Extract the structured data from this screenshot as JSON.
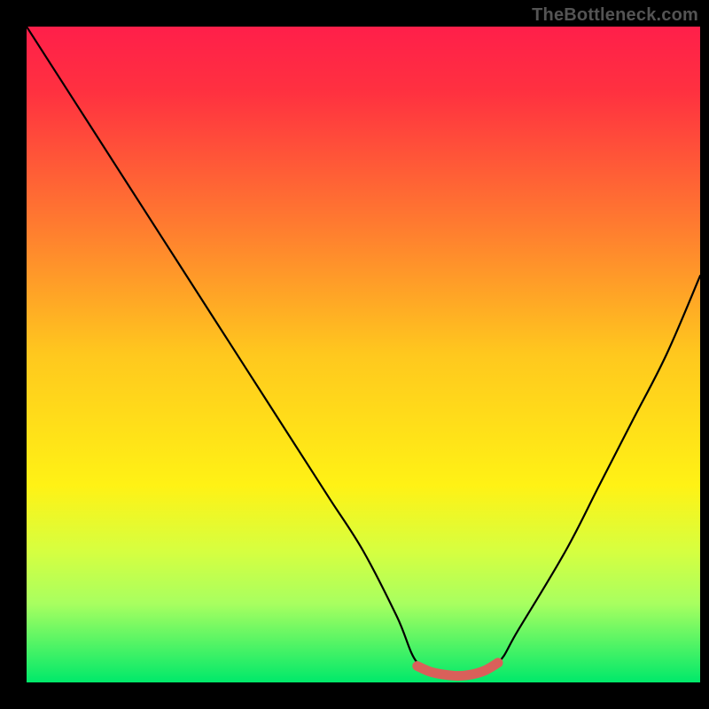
{
  "watermark": "TheBottleneck.com",
  "chart_data": {
    "type": "line",
    "title": "",
    "xlabel": "",
    "ylabel": "",
    "xlim": [
      0,
      100
    ],
    "ylim": [
      0,
      100
    ],
    "gradient_stops": [
      {
        "pos": 0,
        "color": "#ff1f4a"
      },
      {
        "pos": 30,
        "color": "#ff7a30"
      },
      {
        "pos": 50,
        "color": "#ffc81e"
      },
      {
        "pos": 70,
        "color": "#fff215"
      },
      {
        "pos": 88,
        "color": "#a8ff60"
      },
      {
        "pos": 100,
        "color": "#00e96a"
      }
    ],
    "series": [
      {
        "name": "bottleneck-curve",
        "x": [
          0,
          5,
          10,
          15,
          20,
          25,
          30,
          35,
          40,
          45,
          50,
          55,
          58,
          62,
          66,
          70,
          73,
          80,
          85,
          90,
          95,
          100
        ],
        "values": [
          100,
          92,
          84,
          76,
          68,
          60,
          52,
          44,
          36,
          28,
          20,
          10,
          3,
          1,
          1,
          3,
          8,
          20,
          30,
          40,
          50,
          62
        ]
      },
      {
        "name": "optimal-marker",
        "x": [
          58,
          60,
          62,
          64,
          66,
          68,
          70
        ],
        "values": [
          2.5,
          1.6,
          1.2,
          1.0,
          1.2,
          1.8,
          3.0
        ]
      }
    ]
  }
}
